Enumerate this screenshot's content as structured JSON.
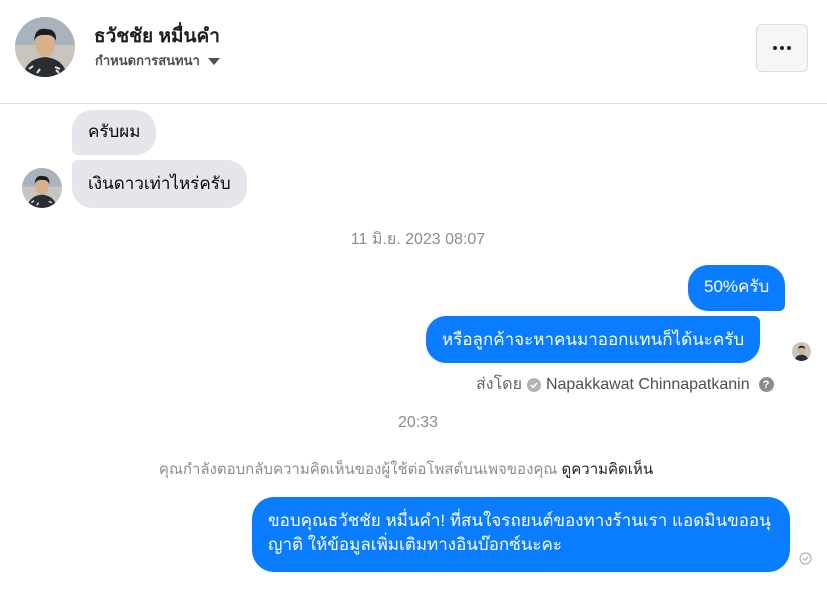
{
  "header": {
    "name": "ธวัชชัย หมื่นคำ",
    "subtitle": "กำหนดการสนทนา"
  },
  "messages": {
    "m1": "ครับผม",
    "m2": "เงินดาวเท่าไหร่ครับ",
    "time1": "11 มิ.ย. 2023 08:07",
    "m3": "50%ครับ",
    "m4": "หรือลูกค้าจะหาคนมาออกแทนก็ได้นะครับ",
    "sent_by_label": "ส่งโดย",
    "sent_by_name": "Napakkawat Chinnapatkanin",
    "time2": "20:33",
    "notice_text": "คุณกำลังตอบกลับความคิดเห็นของผู้ใช้ต่อโพสต์บนเพจของคุณ",
    "notice_link": "ดูความคิดเห็น",
    "m5": "ขอบคุณธวัชชัย หมื่นคำ! ที่สนใจรถยนต์ของทางร้านเรา แอดมินขออนุญาติ ให้ข้อมูลเพิ่มเติมทางอินบ๊อกซ์นะคะ"
  },
  "colors": {
    "outgoing": "#0a7cff",
    "incoming": "#e4e6eb"
  }
}
